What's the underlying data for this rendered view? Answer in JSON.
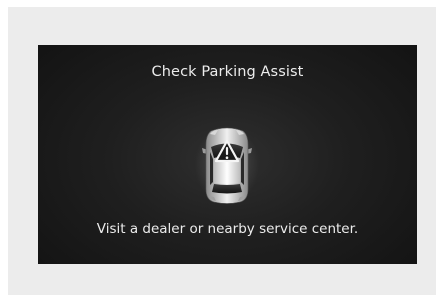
{
  "screen": {
    "title": "Check Parking Assist",
    "message": "Visit a dealer or nearby service center."
  },
  "icons": {
    "vehicle": "car-top-view-icon",
    "warning": "warning-triangle-icon"
  },
  "colors": {
    "screen_background": "#1c1c1c",
    "text": "#ececec",
    "outer_panel": "#ececec"
  }
}
